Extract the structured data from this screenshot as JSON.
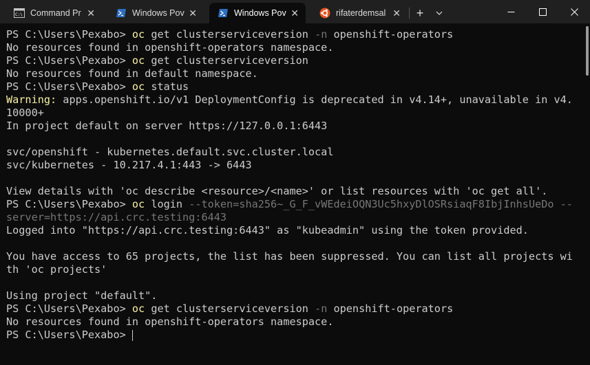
{
  "window": {
    "tabs": [
      {
        "label": "Command Pr",
        "icon": "cmd-icon",
        "active": false
      },
      {
        "label": "Windows Pov",
        "icon": "powershell-icon",
        "active": false
      },
      {
        "label": "Windows Pov",
        "icon": "powershell-icon",
        "active": true
      },
      {
        "label": "rifaterdemsal",
        "icon": "ubuntu-icon",
        "active": false
      }
    ],
    "new_tab": "+",
    "close_glyph": "✕"
  },
  "colors": {
    "background": "#0c0c0c",
    "text": "#cccccc",
    "command": "#f9f1a5",
    "parameter": "#767676",
    "titlebar": "#202020",
    "ubuntu": "#e95420",
    "powershell": "#2c6fc2"
  },
  "console": {
    "lines": [
      {
        "prompt": "PS C:\\Users\\Pexabo> ",
        "cmd": "oc",
        "rest": " get clusterserviceversion ",
        "param": "-n",
        "tail": " openshift-operators"
      },
      {
        "text": "No resources found in openshift-operators namespace."
      },
      {
        "prompt": "PS C:\\Users\\Pexabo> ",
        "cmd": "oc",
        "rest": " get clusterserviceversion"
      },
      {
        "text": "No resources found in default namespace."
      },
      {
        "prompt": "PS C:\\Users\\Pexabo> ",
        "cmd": "oc",
        "rest": " status"
      },
      {
        "warn": "Warning:",
        "text": " apps.openshift.io/v1 DeploymentConfig is deprecated in v4.14+, unavailable in v4."
      },
      {
        "text": "10000+"
      },
      {
        "text": "In project default on server https://127.0.0.1:6443"
      },
      {
        "text": ""
      },
      {
        "text": "svc/openshift - kubernetes.default.svc.cluster.local"
      },
      {
        "text": "svc/kubernetes - 10.217.4.1:443 -> 6443"
      },
      {
        "text": ""
      },
      {
        "text": "View details with 'oc describe <resource>/<name>' or list resources with 'oc get all'."
      },
      {
        "prompt": "PS C:\\Users\\Pexabo> ",
        "cmd": "oc",
        "rest": " login ",
        "param": "--token=sha256~_G_F_vWEdeiOQN3Uc5hxyDlOSRsiaqF8IbjInhsUeDo --"
      },
      {
        "param_only": "server=https://api.crc.testing:6443"
      },
      {
        "text": "Logged into \"https://api.crc.testing:6443\" as \"kubeadmin\" using the token provided."
      },
      {
        "text": ""
      },
      {
        "text": "You have access to 65 projects, the list has been suppressed. You can list all projects wi"
      },
      {
        "text": "th 'oc projects'"
      },
      {
        "text": ""
      },
      {
        "text": "Using project \"default\"."
      },
      {
        "prompt": "PS C:\\Users\\Pexabo> ",
        "cmd": "oc",
        "rest": " get clusterserviceversion ",
        "param": "-n",
        "tail": " openshift-operators"
      },
      {
        "text": "No resources found in openshift-operators namespace."
      },
      {
        "prompt": "PS C:\\Users\\Pexabo> ",
        "cursor": true
      }
    ]
  }
}
